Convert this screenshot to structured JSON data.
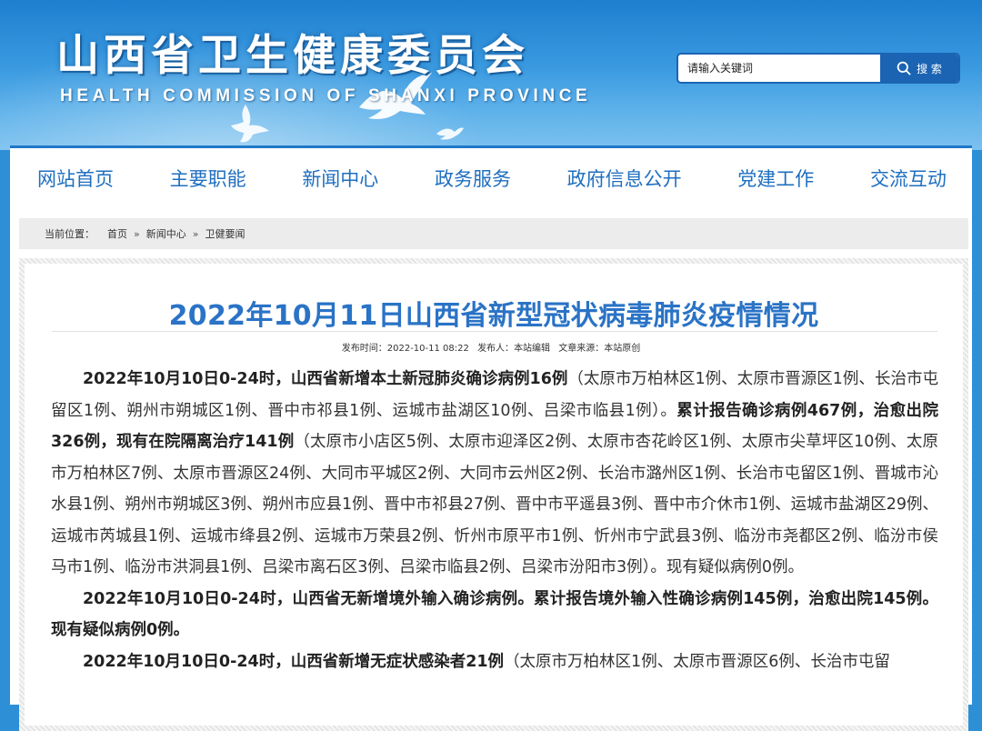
{
  "header": {
    "title": "山西省卫生健康委员会",
    "subtitle": "HEALTH COMMISSION OF SHANXI PROVINCE",
    "search": {
      "placeholder": "请输入关键词",
      "button_label": "搜 索"
    }
  },
  "nav": {
    "items": [
      "网站首页",
      "主要职能",
      "新闻中心",
      "政务服务",
      "政府信息公开",
      "党建工作",
      "交流互动"
    ]
  },
  "breadcrumb": {
    "label": "当前位置：",
    "items": [
      "首页",
      "新闻中心",
      "卫健要闻"
    ],
    "separator": "»"
  },
  "article": {
    "title": "2022年10月11日山西省新型冠状病毒肺炎疫情情况",
    "meta": {
      "publish_time_label": "发布时间：",
      "publish_time": "2022-10-11 08:22",
      "publisher_label": "发布人：",
      "publisher": "本站编辑",
      "source_label": "文章来源：",
      "source": "本站原创"
    },
    "paragraphs": [
      {
        "b1": "2022年10月10日0-24时，山西省新增本土新冠肺炎确诊病例16例",
        "t1": "（太原市万柏林区1例、太原市晋源区1例、长治市屯留区1例、朔州市朔城区1例、晋中市祁县1例、运城市盐湖区10例、吕梁市临县1例）。",
        "b2": "累计报告确诊病例467例，治愈出院326例，现有在院隔离治疗141例",
        "t2": "（太原市小店区5例、太原市迎泽区2例、太原市杏花岭区1例、太原市尖草坪区10例、太原市万柏林区7例、太原市晋源区24例、大同市平城区2例、大同市云州区2例、长治市潞州区1例、长治市屯留区1例、晋城市沁水县1例、朔州市朔城区3例、朔州市应县1例、晋中市祁县27例、晋中市平遥县3例、晋中市介休市1例、运城市盐湖区29例、运城市芮城县1例、运城市绛县2例、运城市万荣县2例、忻州市原平市1例、忻州市宁武县3例、临汾市尧都区2例、临汾市侯马市1例、临汾市洪洞县1例、吕梁市离石区3例、吕梁市临县2例、吕梁市汾阳市3例）。现有疑似病例0例。"
      },
      {
        "b1": "2022年10月10日0-24时，山西省无新增境外输入确诊病例。累计报告境外输入性确诊病例145例，治愈出院145例。现有疑似病例0例。"
      },
      {
        "b1": "2022年10月10日0-24时，山西省新增无症状感染者21例",
        "t1": "（太原市万柏林区1例、太原市晋源区6例、长治市屯留"
      }
    ]
  }
}
